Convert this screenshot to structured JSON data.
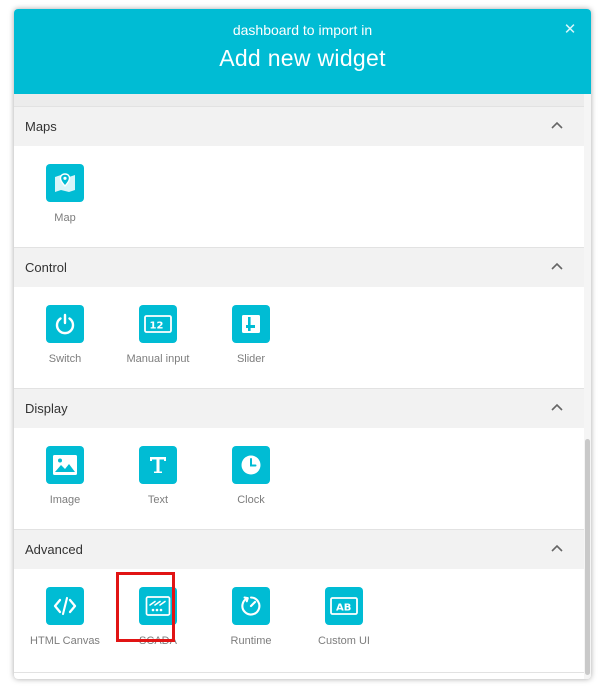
{
  "modal": {
    "subtitle": "dashboard to import in",
    "title": "Add new widget",
    "close_icon": "close-icon"
  },
  "colors": {
    "accent": "#00bcd4",
    "section_bg": "#f2f2f2",
    "highlight": "#e11414",
    "label_text": "#7d7d7d"
  },
  "sections": [
    {
      "title": "Maps",
      "expanded": true,
      "widgets": [
        {
          "label": "Map",
          "icon": "map-icon"
        }
      ]
    },
    {
      "title": "Control",
      "expanded": true,
      "widgets": [
        {
          "label": "Switch",
          "icon": "power-icon"
        },
        {
          "label": "Manual input",
          "icon": "manual-input-icon",
          "icon_text": "12"
        },
        {
          "label": "Slider",
          "icon": "slider-icon"
        }
      ]
    },
    {
      "title": "Display",
      "expanded": true,
      "widgets": [
        {
          "label": "Image",
          "icon": "image-icon"
        },
        {
          "label": "Text",
          "icon": "text-icon"
        },
        {
          "label": "Clock",
          "icon": "clock-icon"
        }
      ]
    },
    {
      "title": "Advanced",
      "expanded": true,
      "widgets": [
        {
          "label": "HTML Canvas",
          "icon": "code-icon"
        },
        {
          "label": "SCADA",
          "icon": "scada-icon",
          "highlighted": true
        },
        {
          "label": "Runtime",
          "icon": "runtime-icon"
        },
        {
          "label": "Custom UI",
          "icon": "custom-ui-icon",
          "icon_text": "AB"
        }
      ]
    }
  ]
}
